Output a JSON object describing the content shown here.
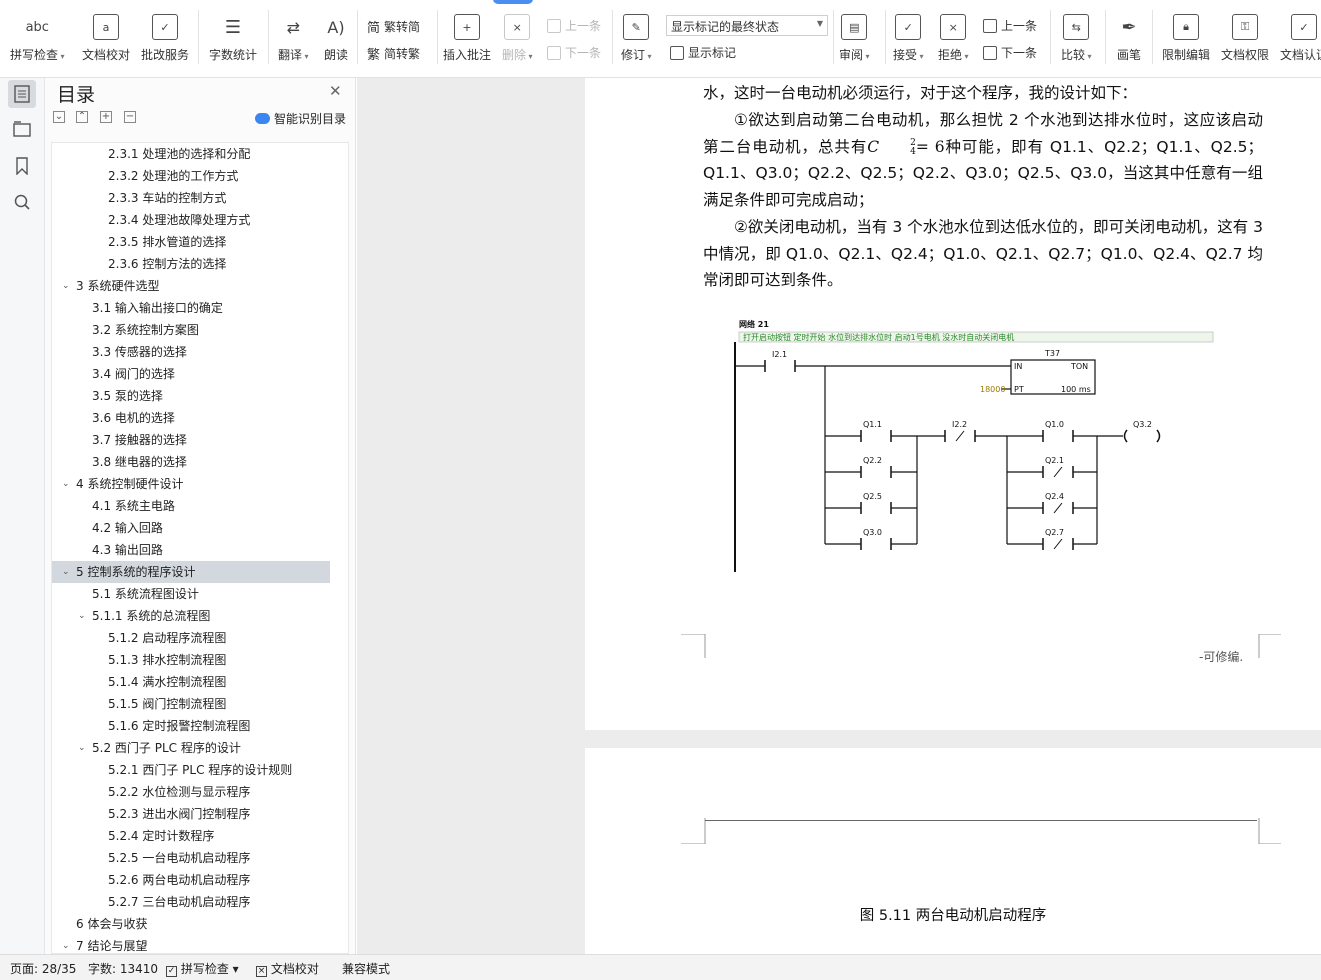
{
  "ribbon": {
    "spell_check": "拼写检查",
    "doc_proof": "文档校对",
    "review_service": "批改服务",
    "word_count": "字数统计",
    "translate": "翻译",
    "read_aloud": "朗读",
    "trad_to_simp": "繁转简",
    "simp_to_trad": "简转繁",
    "insert_comment": "插入批注",
    "delete": "删除",
    "prev_comment": "上一条",
    "next_comment": "下一条",
    "revise": "修订",
    "markup_state": "显示标记的最终状态",
    "show_markup": "显示标记",
    "review_pane": "审阅",
    "accept": "接受",
    "reject": "拒绝",
    "prev_change": "上一条",
    "next_change": "下一条",
    "compare": "比较",
    "pen": "画笔",
    "restrict_edit": "限制编辑",
    "doc_rights": "文档权限",
    "doc_auth": "文档认证"
  },
  "toc": {
    "title": "目录",
    "smart_label": "智能识别目录",
    "items": [
      {
        "text": "2.3.1  处理池的选择和分配",
        "level": 3,
        "caret": ""
      },
      {
        "text": "2.3.2  处理池的工作方式",
        "level": 3,
        "caret": ""
      },
      {
        "text": "2.3.3  车站的控制方式",
        "level": 3,
        "caret": ""
      },
      {
        "text": "2.3.4  处理池故障处理方式",
        "level": 3,
        "caret": ""
      },
      {
        "text": "2.3.5  排水管道的选择",
        "level": 3,
        "caret": ""
      },
      {
        "text": "2.3.6  控制方法的选择",
        "level": 3,
        "caret": ""
      },
      {
        "text": "3  系统硬件选型",
        "level": 1,
        "caret": "v"
      },
      {
        "text": "3.1  输入输出接口的确定",
        "level": 2,
        "caret": ""
      },
      {
        "text": "3.2  系统控制方案图",
        "level": 2,
        "caret": ""
      },
      {
        "text": "3.3  传感器的选择",
        "level": 2,
        "caret": ""
      },
      {
        "text": "3.4  阀门的选择",
        "level": 2,
        "caret": ""
      },
      {
        "text": "3.5  泵的选择",
        "level": 2,
        "caret": ""
      },
      {
        "text": "3.6  电机的选择",
        "level": 2,
        "caret": ""
      },
      {
        "text": "3.7  接触器的选择",
        "level": 2,
        "caret": ""
      },
      {
        "text": "3.8  继电器的选择",
        "level": 2,
        "caret": ""
      },
      {
        "text": "4  系统控制硬件设计",
        "level": 1,
        "caret": "v"
      },
      {
        "text": "4.1  系统主电路",
        "level": 2,
        "caret": ""
      },
      {
        "text": "4.2  输入回路",
        "level": 2,
        "caret": ""
      },
      {
        "text": "4.3  输出回路",
        "level": 2,
        "caret": ""
      },
      {
        "text": "5  控制系统的程序设计",
        "level": 1,
        "caret": "v",
        "selected": true
      },
      {
        "text": "5.1  系统流程图设计",
        "level": 2,
        "caret": ""
      },
      {
        "text": "5.1.1 系统的总流程图",
        "level": 2,
        "caret": "v"
      },
      {
        "text": "5.1.2  启动程序流程图",
        "level": 3,
        "caret": ""
      },
      {
        "text": "5.1.3  排水控制流程图",
        "level": 3,
        "caret": ""
      },
      {
        "text": "5.1.4  满水控制流程图",
        "level": 3,
        "caret": ""
      },
      {
        "text": "5.1.5  阀门控制流程图",
        "level": 3,
        "caret": ""
      },
      {
        "text": "5.1.6  定时报警控制流程图",
        "level": 3,
        "caret": ""
      },
      {
        "text": "5.2  西门子 PLC 程序的设计",
        "level": 2,
        "caret": "v"
      },
      {
        "text": "5.2.1  西门子 PLC 程序的设计规则",
        "level": 3,
        "caret": ""
      },
      {
        "text": "5.2.2  水位检测与显示程序",
        "level": 3,
        "caret": ""
      },
      {
        "text": "5.2.3  进出水阀门控制程序",
        "level": 3,
        "caret": ""
      },
      {
        "text": "5.2.4  定时计数程序",
        "level": 3,
        "caret": ""
      },
      {
        "text": "5.2.5  一台电动机启动程序",
        "level": 3,
        "caret": ""
      },
      {
        "text": "5.2.6  两台电动机启动程序",
        "level": 3,
        "caret": ""
      },
      {
        "text": "5.2.7  三台电动机启动程序",
        "level": 3,
        "caret": ""
      },
      {
        "text": "6  体会与收获",
        "level": 1,
        "caret": ""
      },
      {
        "text": "7  结论与展望",
        "level": 1,
        "caret": "v"
      }
    ]
  },
  "document": {
    "p1": "水，这时一台电动机必须运行，对于这个程序，我的设计如下：",
    "p2_start": "①欲达到启动第二台电动机，那么担忧 2 个水池到达排水位时，这应该启动第二台电动机，总共有",
    "formula_C": "C",
    "formula_sup": "2",
    "formula_sub": "4",
    "formula_rest": "= 6",
    "p2_end": "种可能，即有 Q1.1、Q2.2；Q1.1、Q2.5；Q1.1、Q3.0；Q2.2、Q2.5；Q2.2、Q3.0；Q2.5、Q3.0，当这其中任意有一组满足条件即可完成启动；",
    "p3": "②欲关闭电动机，当有 3 个水池水位到达低水位的，即可关闭电动机，这有 3 中情况，即 Q1.0、Q2.1、Q2.4；Q1.0、Q2.1、Q2.7；Q1.0、Q2.4、Q2.7 均常闭即可达到条件。",
    "footer_note": "-可修编.",
    "caption": "图 5.11  两台电动机启动程序",
    "ladder": {
      "network": "网络 21",
      "comment": "打开启动按钮 定时开始 水位到达排水位时 启动1号电机 没水时自动关闭电机",
      "input": "I2.1",
      "timer": "T37",
      "timer_in": "IN",
      "timer_type": "TON",
      "timer_pt": "PT",
      "timer_preset": "18000",
      "timer_unit": "100 ms",
      "branch1": [
        "Q1.1",
        "Q2.2",
        "Q2.5",
        "Q3.0"
      ],
      "contact_mid": "I2.2",
      "branch2": [
        "Q1.0",
        "Q2.1",
        "Q2.4",
        "Q2.7"
      ],
      "coil": "Q3.2"
    }
  },
  "status": {
    "page": "页面: 28/35",
    "words": "字数: 13410",
    "spell": "拼写检查",
    "proof": "文档校对",
    "compat": "兼容模式"
  }
}
